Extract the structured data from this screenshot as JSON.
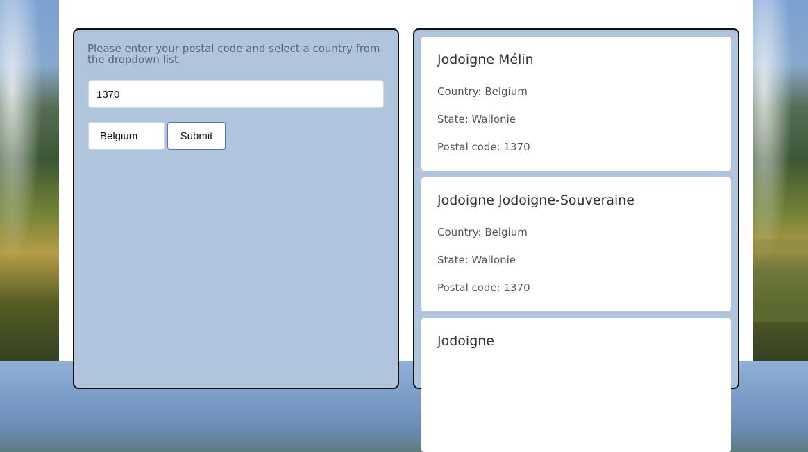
{
  "form": {
    "instructions": "Please enter your postal code and select a country from the dropdown list.",
    "postal_code_value": "1370",
    "country_selected": "Belgium",
    "submit_label": "Submit"
  },
  "results": [
    {
      "title": "Jodoigne Mélin",
      "country": "Country: Belgium",
      "state": "State: Wallonie",
      "postal_code": "Postal code: 1370"
    },
    {
      "title": "Jodoigne Jodoigne-Souveraine",
      "country": "Country: Belgium",
      "state": "State: Wallonie",
      "postal_code": "Postal code: 1370"
    },
    {
      "title": "Jodoigne"
    }
  ],
  "colors": {
    "panel_bg": "#b0c4de",
    "card_bg": "#ffffff",
    "submit_border": "#5470d8"
  }
}
